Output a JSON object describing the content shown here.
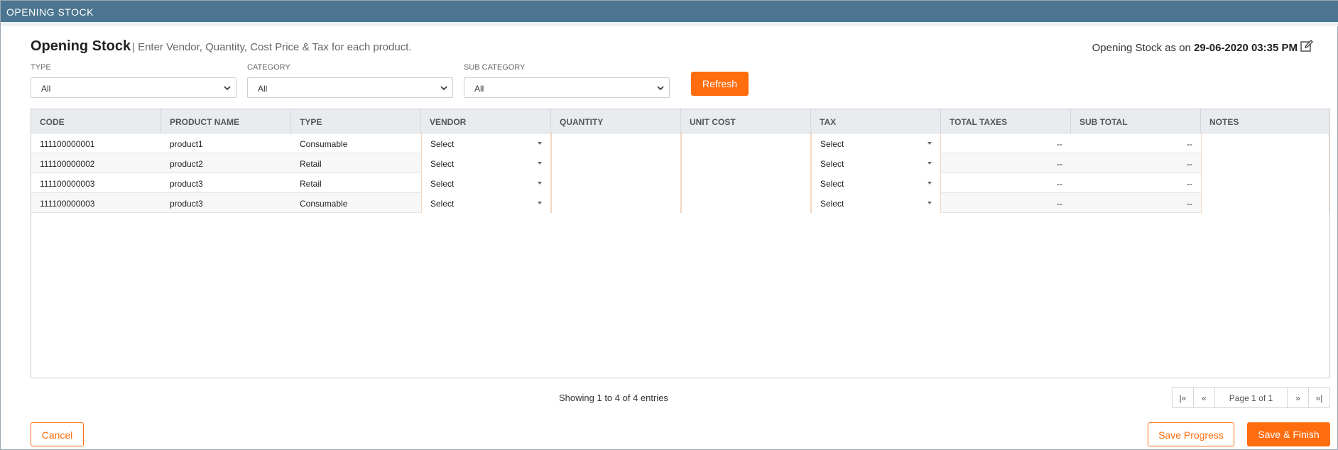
{
  "window": {
    "title": "OPENING STOCK"
  },
  "header": {
    "title": "Opening Stock",
    "subtitle": "| Enter Vendor, Quantity, Cost Price & Tax for each product.",
    "as_of_label": "Opening Stock as on",
    "as_of_value": "29-06-2020 03:35 PM"
  },
  "filters": {
    "type": {
      "label": "TYPE",
      "value": "All"
    },
    "category": {
      "label": "CATEGORY",
      "value": "All"
    },
    "sub_category": {
      "label": "SUB CATEGORY",
      "value": "All"
    },
    "refresh_label": "Refresh"
  },
  "table": {
    "columns": [
      "CODE",
      "PRODUCT NAME",
      "TYPE",
      "VENDOR",
      "QUANTITY",
      "UNIT COST",
      "TAX",
      "TOTAL TAXES",
      "SUB TOTAL",
      "NOTES"
    ],
    "rows": [
      {
        "code": "111100000001",
        "product": "product1",
        "type": "Consumable",
        "vendor": "Select",
        "quantity": "",
        "unit_cost": "",
        "tax": "Select",
        "total_taxes": "--",
        "sub_total": "--",
        "notes": ""
      },
      {
        "code": "111100000002",
        "product": "product2",
        "type": "Retail",
        "vendor": "Select",
        "quantity": "",
        "unit_cost": "",
        "tax": "Select",
        "total_taxes": "--",
        "sub_total": "--",
        "notes": ""
      },
      {
        "code": "111100000003",
        "product": "product3",
        "type": "Retail",
        "vendor": "Select",
        "quantity": "",
        "unit_cost": "",
        "tax": "Select",
        "total_taxes": "--",
        "sub_total": "--",
        "notes": ""
      },
      {
        "code": "111100000003",
        "product": "product3",
        "type": "Consumable",
        "vendor": "Select",
        "quantity": "",
        "unit_cost": "",
        "tax": "Select",
        "total_taxes": "--",
        "sub_total": "--",
        "notes": ""
      }
    ]
  },
  "footer": {
    "showing": "Showing 1 to 4 of 4 entries",
    "pager": {
      "first": "|«",
      "prev": "«",
      "page": "Page 1 of 1",
      "next": "»",
      "last": "»|"
    },
    "cancel_label": "Cancel",
    "save_progress_label": "Save Progress",
    "save_finish_label": "Save & Finish"
  },
  "icons": {
    "edit": "edit-icon",
    "dropdown": "chevron-down-icon"
  },
  "colors": {
    "titlebar": "#4b7590",
    "accent": "#ff6d0f",
    "header_row": "#e9ecef"
  }
}
